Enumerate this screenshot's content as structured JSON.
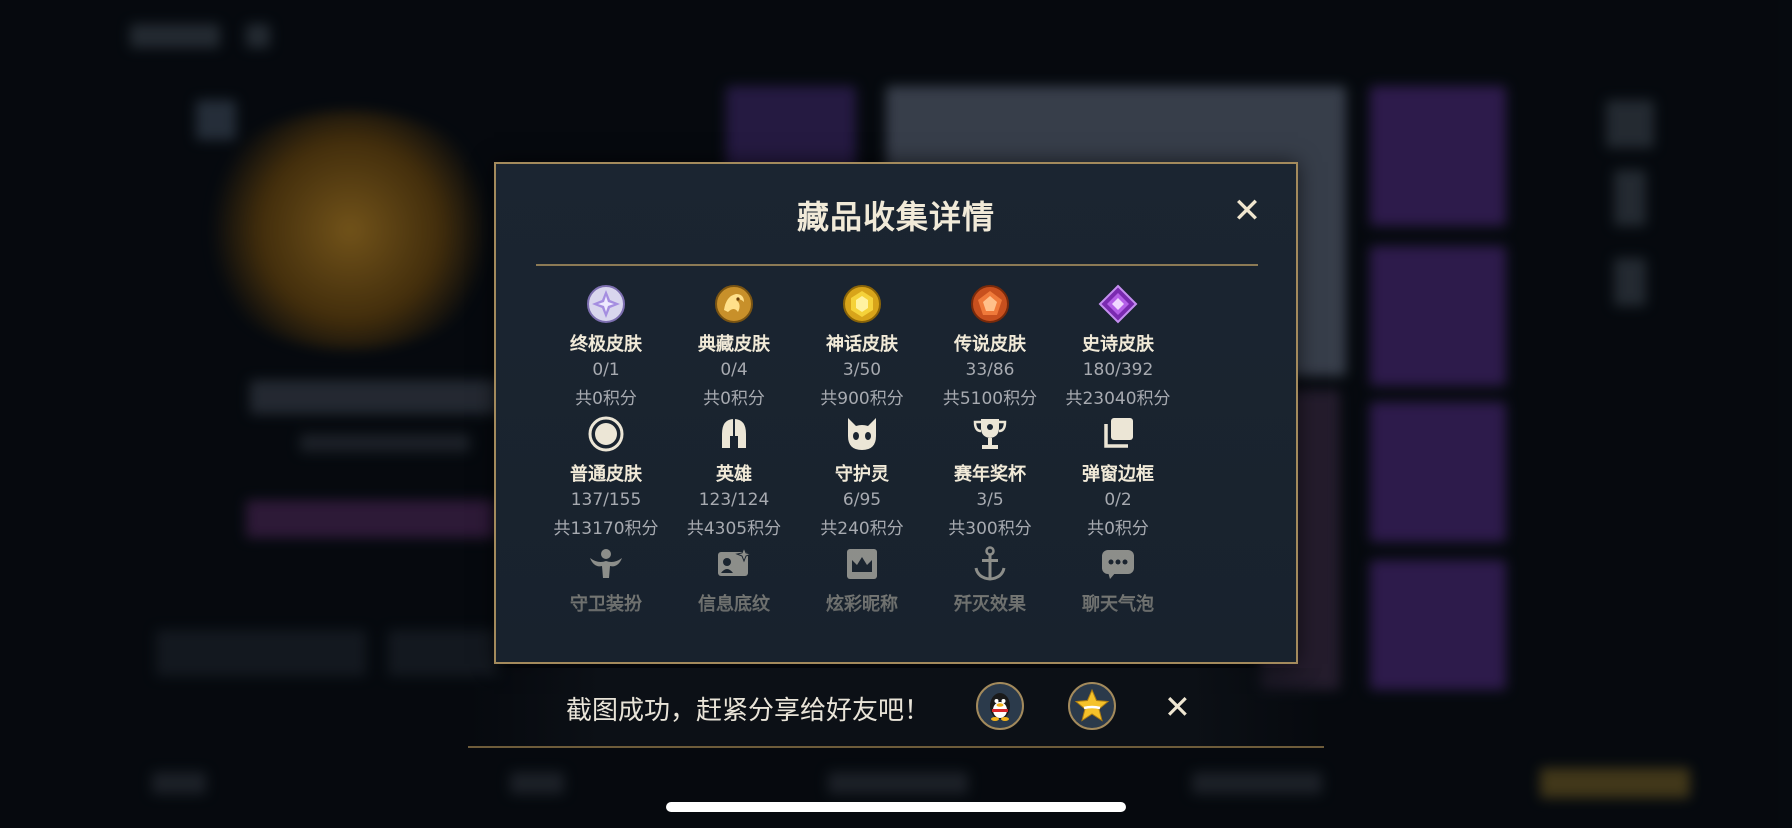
{
  "modal": {
    "title": "藏品收集详情",
    "close_glyph": "✕"
  },
  "categories_row1": [
    {
      "icon": "ultimate-gem-icon",
      "name": "终极皮肤",
      "count": "0/1",
      "points": "共0积分"
    },
    {
      "icon": "dragon-emblem-icon",
      "name": "典藏皮肤",
      "count": "0/4",
      "points": "共0积分"
    },
    {
      "icon": "myth-gem-icon",
      "name": "神话皮肤",
      "count": "3/50",
      "points": "共900积分"
    },
    {
      "icon": "legend-gem-icon",
      "name": "传说皮肤",
      "count": "33/86",
      "points": "共5100积分"
    },
    {
      "icon": "epic-gem-icon",
      "name": "史诗皮肤",
      "count": "180/392",
      "points": "共23040积分"
    }
  ],
  "categories_row2": [
    {
      "icon": "circle-icon",
      "name": "普通皮肤",
      "count": "137/155",
      "points": "共13170积分"
    },
    {
      "icon": "helmet-icon",
      "name": "英雄",
      "count": "123/124",
      "points": "共4305积分"
    },
    {
      "icon": "spirit-icon",
      "name": "守护灵",
      "count": "6/95",
      "points": "共240积分"
    },
    {
      "icon": "trophy-icon",
      "name": "赛年奖杯",
      "count": "3/5",
      "points": "共300积分"
    },
    {
      "icon": "frame-icon",
      "name": "弹窗边框",
      "count": "0/2",
      "points": "共0积分"
    }
  ],
  "categories_row3": [
    {
      "icon": "guardian-outfit-icon",
      "name": "守卫装扮"
    },
    {
      "icon": "card-pattern-icon",
      "name": "信息底纹"
    },
    {
      "icon": "crown-card-icon",
      "name": "炫彩昵称"
    },
    {
      "icon": "anchor-icon",
      "name": "歼灭效果"
    },
    {
      "icon": "chat-bubble-icon",
      "name": "聊天气泡"
    }
  ],
  "share_bar": {
    "message": "截图成功，赶紧分享给好友吧！",
    "buttons": [
      {
        "icon": "qq-penguin-icon"
      },
      {
        "icon": "qzone-star-icon"
      }
    ],
    "close_glyph": "✕"
  },
  "colors": {
    "modal_border": "#a38a5c",
    "modal_bg": "#1b2531",
    "title_text": "#f1ead8",
    "muted_text": "#a7aab0"
  }
}
